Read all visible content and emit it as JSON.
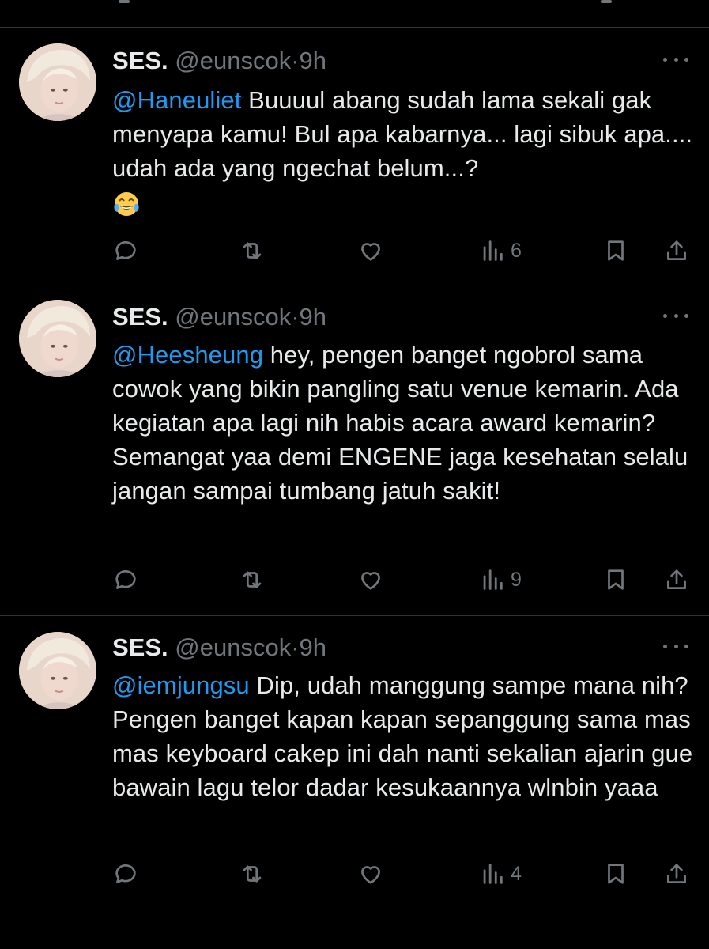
{
  "colors": {
    "background": "#000000",
    "text": "#e7e9ea",
    "muted": "#71767b",
    "mention": "#1d9bf0",
    "divider": "#2f3336"
  },
  "tweets": [
    {
      "name": "SES.",
      "handle": "@eunscok",
      "dot": "·",
      "time": "9h",
      "mention": "@Haneuliet",
      "text": " Buuuul abang sudah lama sekali gak menyapa kamu! Bul apa kabarnya... lagi sibuk apa.... udah ada yang ngechat belum...?",
      "emoji": "face-with-tears-of-joy",
      "views": "6"
    },
    {
      "name": "SES.",
      "handle": "@eunscok",
      "dot": "·",
      "time": "9h",
      "mention": "@Heesheung",
      "text": " hey, pengen banget ngobrol sama cowok yang bikin pangling satu venue kemarin. Ada kegiatan apa lagi nih habis acara award kemarin? Semangat yaa demi ENGENE jaga kesehatan selalu jangan sampai tumbang jatuh sakit!",
      "views": "9"
    },
    {
      "name": "SES.",
      "handle": "@eunscok",
      "dot": "·",
      "time": "9h",
      "mention": "@iemjungsu",
      "text": " Dip, udah manggung sampe mana nih? Pengen banget kapan kapan sepanggung sama mas mas keyboard cakep ini dah nanti sekalian ajarin gue bawain lagu telor dadar kesukaannya wlnbin yaaa",
      "views": "4"
    }
  ],
  "icons": {
    "reply": "reply-icon",
    "retweet": "retweet-icon",
    "like": "like-icon",
    "views": "views-icon",
    "bookmark": "bookmark-icon",
    "share": "share-icon",
    "more": "more-icon"
  }
}
